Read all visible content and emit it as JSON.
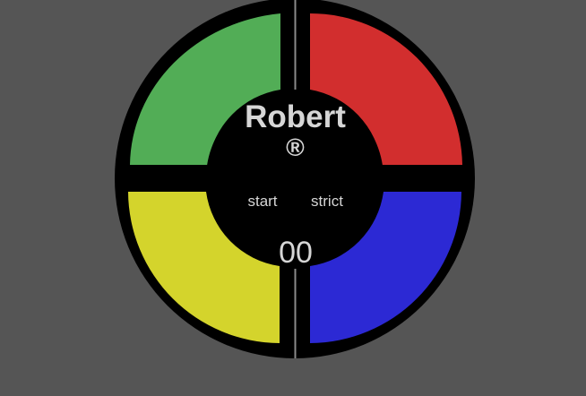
{
  "game": {
    "brand": "Robert",
    "registered_mark": "®",
    "start_label": "start",
    "strict_label": "strict",
    "count": "00"
  },
  "colors": {
    "background": "#555555",
    "green": "#52ad56",
    "red": "#d22e2e",
    "yellow": "#d4d42c",
    "blue": "#2c29d4",
    "body": "#000000",
    "text": "#d6d6d6"
  },
  "pads": [
    "green-pad",
    "red-pad",
    "yellow-pad",
    "blue-pad"
  ]
}
